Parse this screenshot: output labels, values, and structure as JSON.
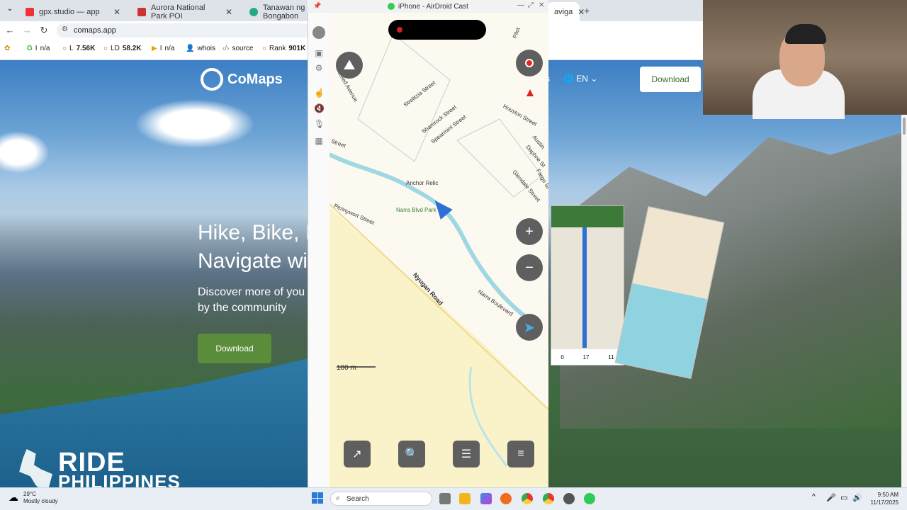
{
  "browser": {
    "tabs": [
      {
        "title": "gpx.studio — app",
        "color": "#e33"
      },
      {
        "title": "Aurora National Park POI",
        "color": "#c33"
      },
      {
        "title": "Tanawan ng Bongabon",
        "color": "#2a8"
      }
    ],
    "partial_tab": "aviga",
    "url": "comaps.app",
    "extensions": [
      {
        "label": "n/a",
        "prefix": "I"
      },
      {
        "label": "7.56K",
        "prefix": "L"
      },
      {
        "label": "58.2K",
        "prefix": "LD"
      },
      {
        "label": "n/a",
        "prefix": "I"
      },
      {
        "label": "whois",
        "prefix": ""
      },
      {
        "label": "source",
        "prefix": ""
      },
      {
        "label": "901K",
        "prefix": "Rank"
      }
    ]
  },
  "website": {
    "brand": "CoMaps",
    "language": "EN",
    "header_download": "Download",
    "hero_line1": "Hike, Bike, D",
    "hero_line2": "Navigate wit",
    "hero_sub": "Discover more of you by the community",
    "download": "Download"
  },
  "airdroid": {
    "title": "iPhone - AirDroid Cast",
    "map": {
      "streets": [
        "Strelitzia Street",
        "Shamrock Street",
        "Spearmint Street",
        "Houston Street",
        "Austin",
        "Daphne St",
        "Fargo St",
        "Glendale Street",
        "Pennywort Street",
        "Nyugan Road",
        "Narra Boulevard",
        "Street",
        "Reed Avenue",
        "Pilot"
      ],
      "poi_anchor": "Anchor Relic",
      "poi_park": "Narra Blvd Park",
      "scale": "100 m"
    }
  },
  "branding": {
    "ride": "RIDE",
    "philippines": "PHILIPPINES"
  },
  "taskbar": {
    "search": "Search",
    "temp": "29°C",
    "weather": "Mostly cloudy",
    "time": "9:50 AM",
    "date": "11/17/2025"
  }
}
